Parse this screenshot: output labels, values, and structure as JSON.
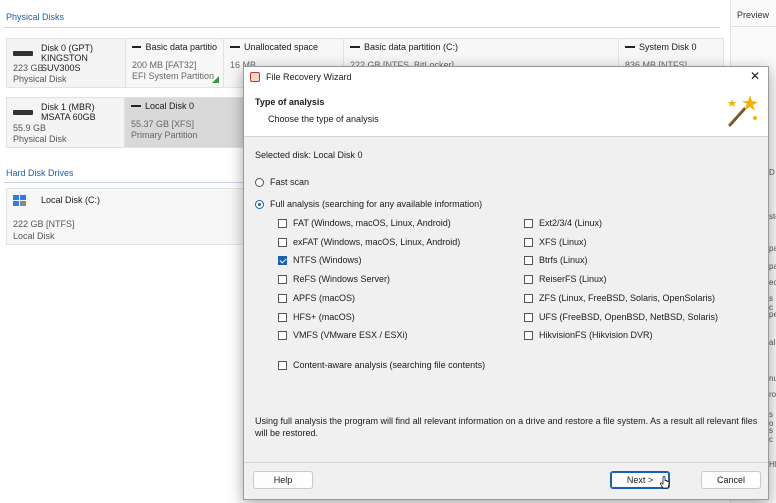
{
  "background": {
    "physical_disks_header": "Physical Disks",
    "hard_disk_drives_header": "Hard Disk Drives",
    "disk0": {
      "name": "Disk 0 (GPT)",
      "model": "KINGSTON SUV300S",
      "size": "223 GB",
      "type": "Physical Disk",
      "partitions": [
        {
          "name": "Basic data partitio",
          "size": "200 MB [FAT32]",
          "type": "EFI System Partition"
        },
        {
          "name": "Unallocated space",
          "size": "16 MB",
          "type": ""
        },
        {
          "name": "Basic data partition (C:)",
          "size": "222 GB [NTFS, BitLocker]",
          "type": ""
        },
        {
          "name": "System Disk 0",
          "size": "836 MB [NTFS]",
          "type": ""
        }
      ]
    },
    "disk1": {
      "name": "Disk 1 (MBR)",
      "model": "MSATA 60GB",
      "size": "55.9 GB",
      "type": "Physical Disk",
      "partitions": [
        {
          "name": "Local Disk 0",
          "size": "55.37 GB [XFS]",
          "type": "Primary Partition"
        }
      ]
    },
    "local_disk": {
      "name": "Local Disk (C:)",
      "size": "222 GB [NTFS]",
      "type": "Local Disk"
    },
    "preview_title": "Preview",
    "preview_fragments": [
      "D",
      "ste",
      "pa",
      "pa",
      "ect",
      "s c",
      "pe",
      "al",
      "nu",
      "rov",
      "s o",
      "s c",
      "HE"
    ]
  },
  "dialog": {
    "title": "File Recovery Wizard",
    "heading": "Type of analysis",
    "subheading": "Choose the type of analysis",
    "selected_disk": "Selected disk: Local Disk 0",
    "fast_scan": "Fast scan",
    "full_analysis": "Full analysis (searching for any available information)",
    "fs_left": [
      {
        "label": "FAT (Windows, macOS, Linux, Android)",
        "checked": false
      },
      {
        "label": "exFAT (Windows, macOS, Linux, Android)",
        "checked": false
      },
      {
        "label": "NTFS (Windows)",
        "checked": true
      },
      {
        "label": "ReFS (Windows Server)",
        "checked": false
      },
      {
        "label": "APFS (macOS)",
        "checked": false
      },
      {
        "label": "HFS+ (macOS)",
        "checked": false
      },
      {
        "label": "VMFS (VMware ESX / ESXi)",
        "checked": false
      }
    ],
    "fs_right": [
      {
        "label": "Ext2/3/4 (Linux)",
        "checked": false
      },
      {
        "label": "XFS (Linux)",
        "checked": false
      },
      {
        "label": "Btrfs (Linux)",
        "checked": false
      },
      {
        "label": "ReiserFS (Linux)",
        "checked": false
      },
      {
        "label": "ZFS (Linux, FreeBSD, Solaris, OpenSolaris)",
        "checked": false
      },
      {
        "label": "UFS (FreeBSD, OpenBSD, NetBSD, Solaris)",
        "checked": false
      },
      {
        "label": "HikvisionFS (Hikvision DVR)",
        "checked": false
      }
    ],
    "content_aware": "Content-aware analysis (searching file contents)",
    "description": "Using full analysis the program will find all relevant information on a drive and restore a file system. As a result all relevant files will be restored.",
    "help_label": "Help",
    "next_label": "Next >",
    "cancel_label": "Cancel",
    "close_symbol": "✕"
  },
  "colors": {
    "accent": "#1a5fb4",
    "section_header": "#1f5fa8"
  }
}
